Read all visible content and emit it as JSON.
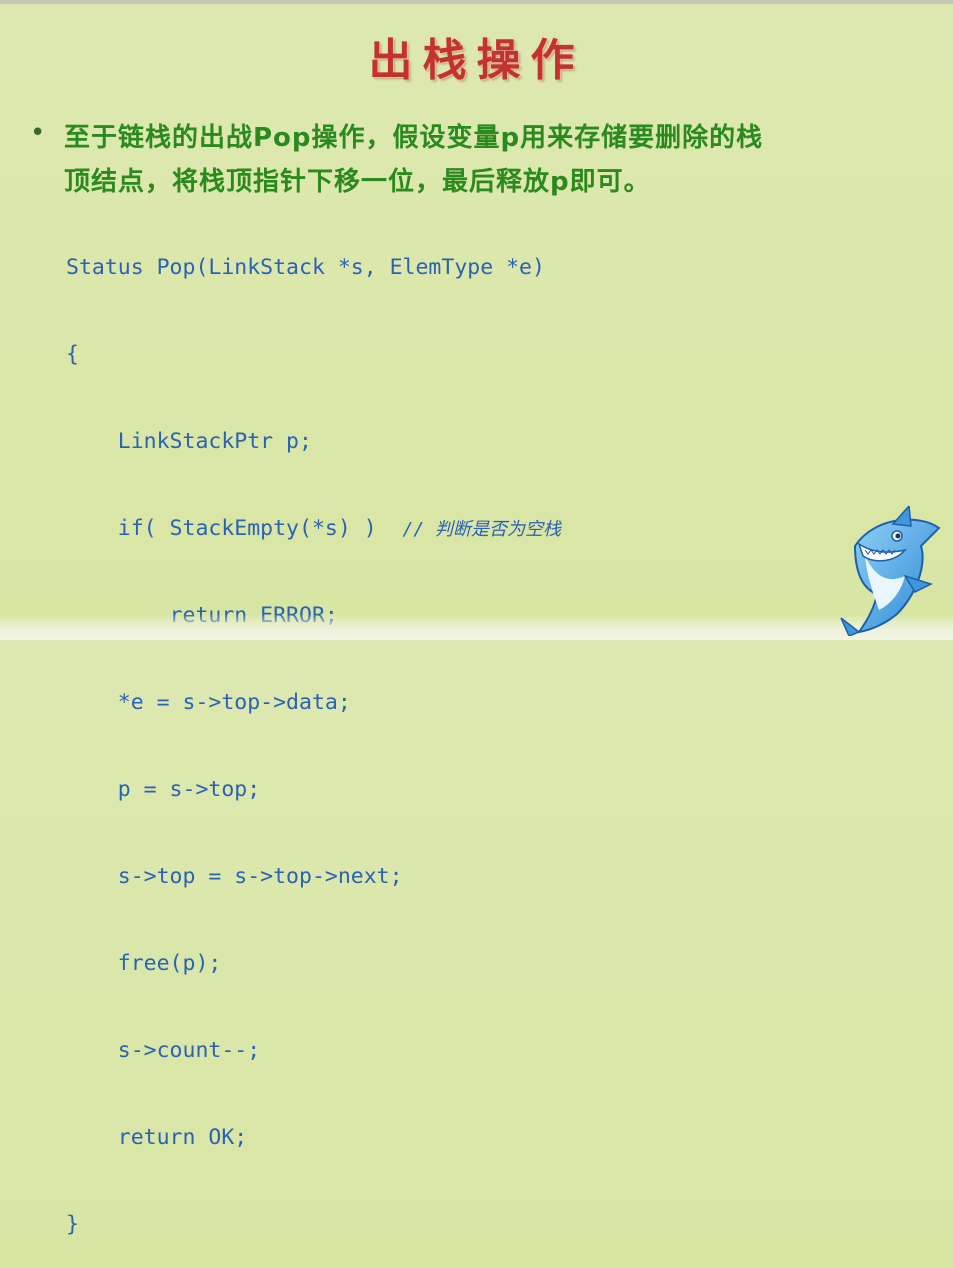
{
  "slide": {
    "title": "出栈操作",
    "bullet_line1": "至于链栈的出战Pop操作，假设变量p用来存储要删除的栈",
    "bullet_line2": "顶结点，将栈顶指针下移一位，最后释放p即可。",
    "code_lines": [
      "Status Pop(LinkStack *s, ElemType *e)",
      "{",
      "    LinkStackPtr p;",
      "    if( StackEmpty(*s) )  ",
      "        return ERROR;",
      "    *e = s->top->data;",
      "    p = s->top;",
      "    s->top = s->top->next;",
      "    free(p);",
      "    s->count--;",
      "    return OK;",
      "}"
    ],
    "code_comment": "// 判断是否为空栈",
    "mascot_icon": "shark-mascot-icon",
    "colors": {
      "title": "#c3322b",
      "text": "#2b8a1d",
      "code": "#2a62b4",
      "background": "#d8e6a4"
    }
  }
}
